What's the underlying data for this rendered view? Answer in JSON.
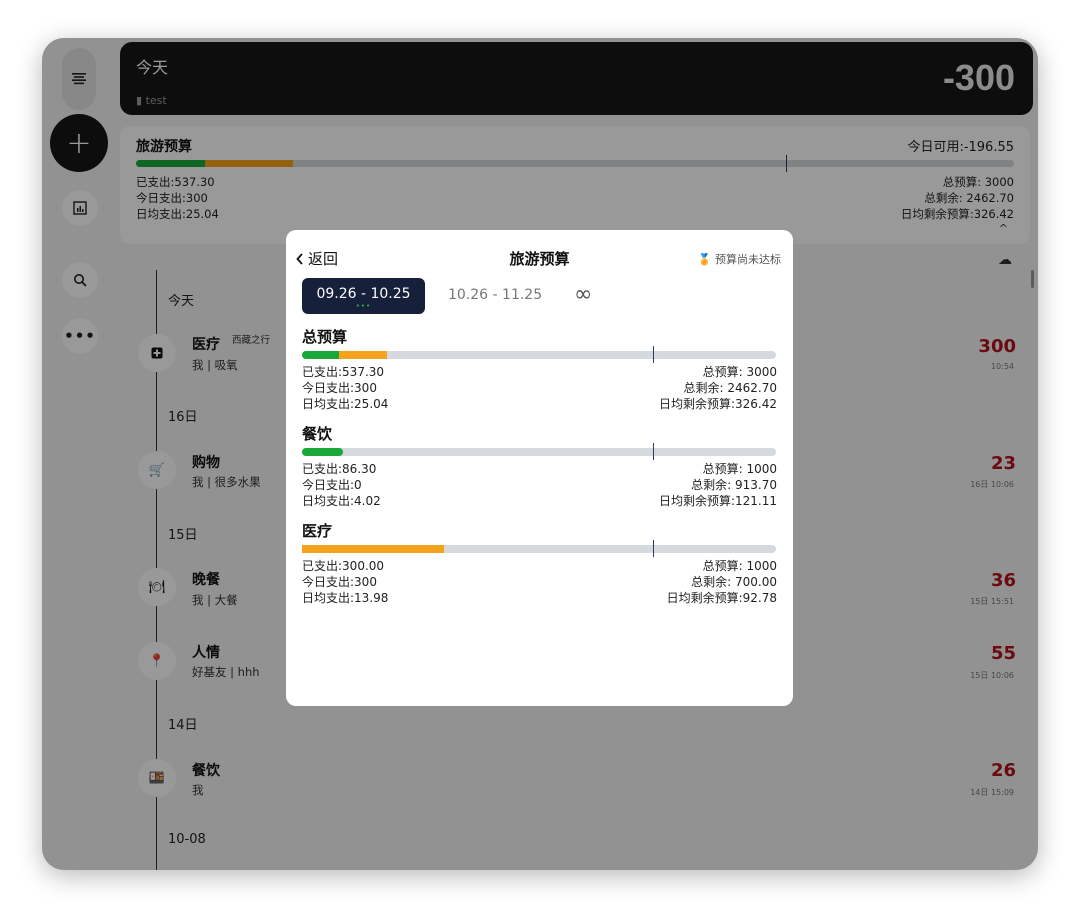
{
  "header": {
    "title": "今天",
    "book": "test",
    "amount": "-300"
  },
  "budget": {
    "name": "旅游预算",
    "today_available": "今日可用:-196.55",
    "bar": {
      "spent_fraction": 0.179,
      "today_fraction": 0.1,
      "elapsed_fraction": 0.74
    },
    "spent": "已支出:537.30",
    "today": "今日支出:300",
    "daily_avg": "日均支出:25.04",
    "total": "总预算: 3000",
    "remaining": "总剩余: 2462.70",
    "daily_remaining": "日均剩余预算:326.42"
  },
  "timeline": {
    "dates": [
      "今天",
      "16日",
      "15日",
      "14日",
      "10-08"
    ],
    "entries": [
      {
        "category": "医疗",
        "tag": "西藏之行",
        "note": "我 | 吸氧",
        "amount": "300",
        "time": "10:54",
        "icon": "medical-icon"
      },
      {
        "category": "购物",
        "tag": "",
        "note": "我 | 很多水果",
        "amount": "23",
        "time": "16日 10:06",
        "icon": "cart-icon"
      },
      {
        "category": "晚餐",
        "tag": "",
        "note": "我 | 大餐",
        "amount": "36",
        "time": "15日 15:51",
        "icon": "dinner-icon"
      },
      {
        "category": "人情",
        "tag": "",
        "note": "好基友 | hhh",
        "amount": "55",
        "time": "15日 10:06",
        "icon": "pin-icon"
      },
      {
        "category": "餐饮",
        "tag": "",
        "note": "我",
        "amount": "26",
        "time": "14日 15:09",
        "icon": "food-icon"
      }
    ]
  },
  "modal": {
    "back_label": "返回",
    "title": "旅游预算",
    "status": "预算尚未达标",
    "periods": [
      "09.26 - 10.25",
      "10.26 - 11.25",
      "∞"
    ],
    "sections": [
      {
        "title": "总预算",
        "spent": "已支出:537.30",
        "today": "今日支出:300",
        "daily_avg": "日均支出:25.04",
        "total": "总预算: 3000",
        "remaining": "总剩余: 2462.70",
        "daily_remaining": "日均剩余预算:326.42",
        "bar": {
          "spent_fraction": 0.179,
          "today_fraction": 0.1,
          "elapsed_fraction": 0.74
        }
      },
      {
        "title": "餐饮",
        "spent": "已支出:86.30",
        "today": "今日支出:0",
        "daily_avg": "日均支出:4.02",
        "total": "总预算: 1000",
        "remaining": "总剩余: 913.70",
        "daily_remaining": "日均剩余预算:121.11",
        "bar": {
          "spent_fraction": 0.0863,
          "today_fraction": 0,
          "elapsed_fraction": 0.74
        }
      },
      {
        "title": "医疗",
        "spent": "已支出:300.00",
        "today": "今日支出:300",
        "daily_avg": "日均支出:13.98",
        "total": "总预算: 1000",
        "remaining": "总剩余: 700.00",
        "daily_remaining": "日均剩余预算:92.78",
        "bar": {
          "spent_fraction": 0.3,
          "today_fraction": 0.3,
          "elapsed_fraction": 0.74
        }
      }
    ]
  },
  "colors": {
    "spent": "#1aa83a",
    "today": "#f5a21c",
    "track": "#d6d9dd",
    "amount": "#b3121b",
    "dark": "#161616"
  }
}
